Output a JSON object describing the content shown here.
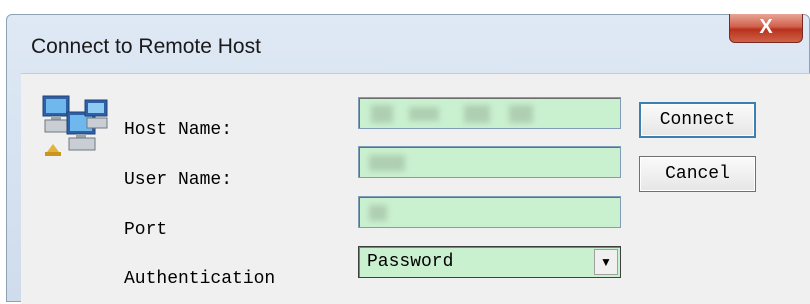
{
  "window": {
    "title": "Connect to Remote Host",
    "close_glyph": "X"
  },
  "form": {
    "host_label": "Host Name:",
    "user_label": "User Name:",
    "port_label": "Port",
    "auth_label": "Authentication",
    "auth_selected": "Password",
    "field_bg_color": "#c9f0cf"
  },
  "buttons": {
    "connect": "Connect",
    "cancel": "Cancel"
  },
  "icons": {
    "app": "network-computers-icon",
    "dropdown": "chevron-down-icon"
  }
}
